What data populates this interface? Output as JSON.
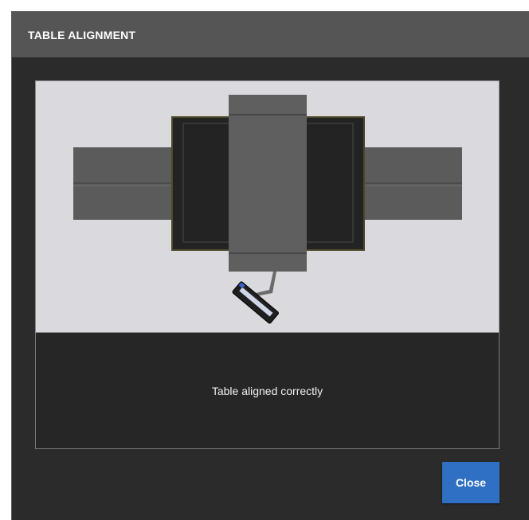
{
  "dialog": {
    "title": "TABLE ALIGNMENT",
    "status_message": "Table aligned correctly",
    "close_label": "Close"
  },
  "colors": {
    "title_bar": "#555555",
    "dialog_background": "#2b2b2b",
    "scene_background": "#d9d9de",
    "close_button": "#2f6fc4"
  }
}
